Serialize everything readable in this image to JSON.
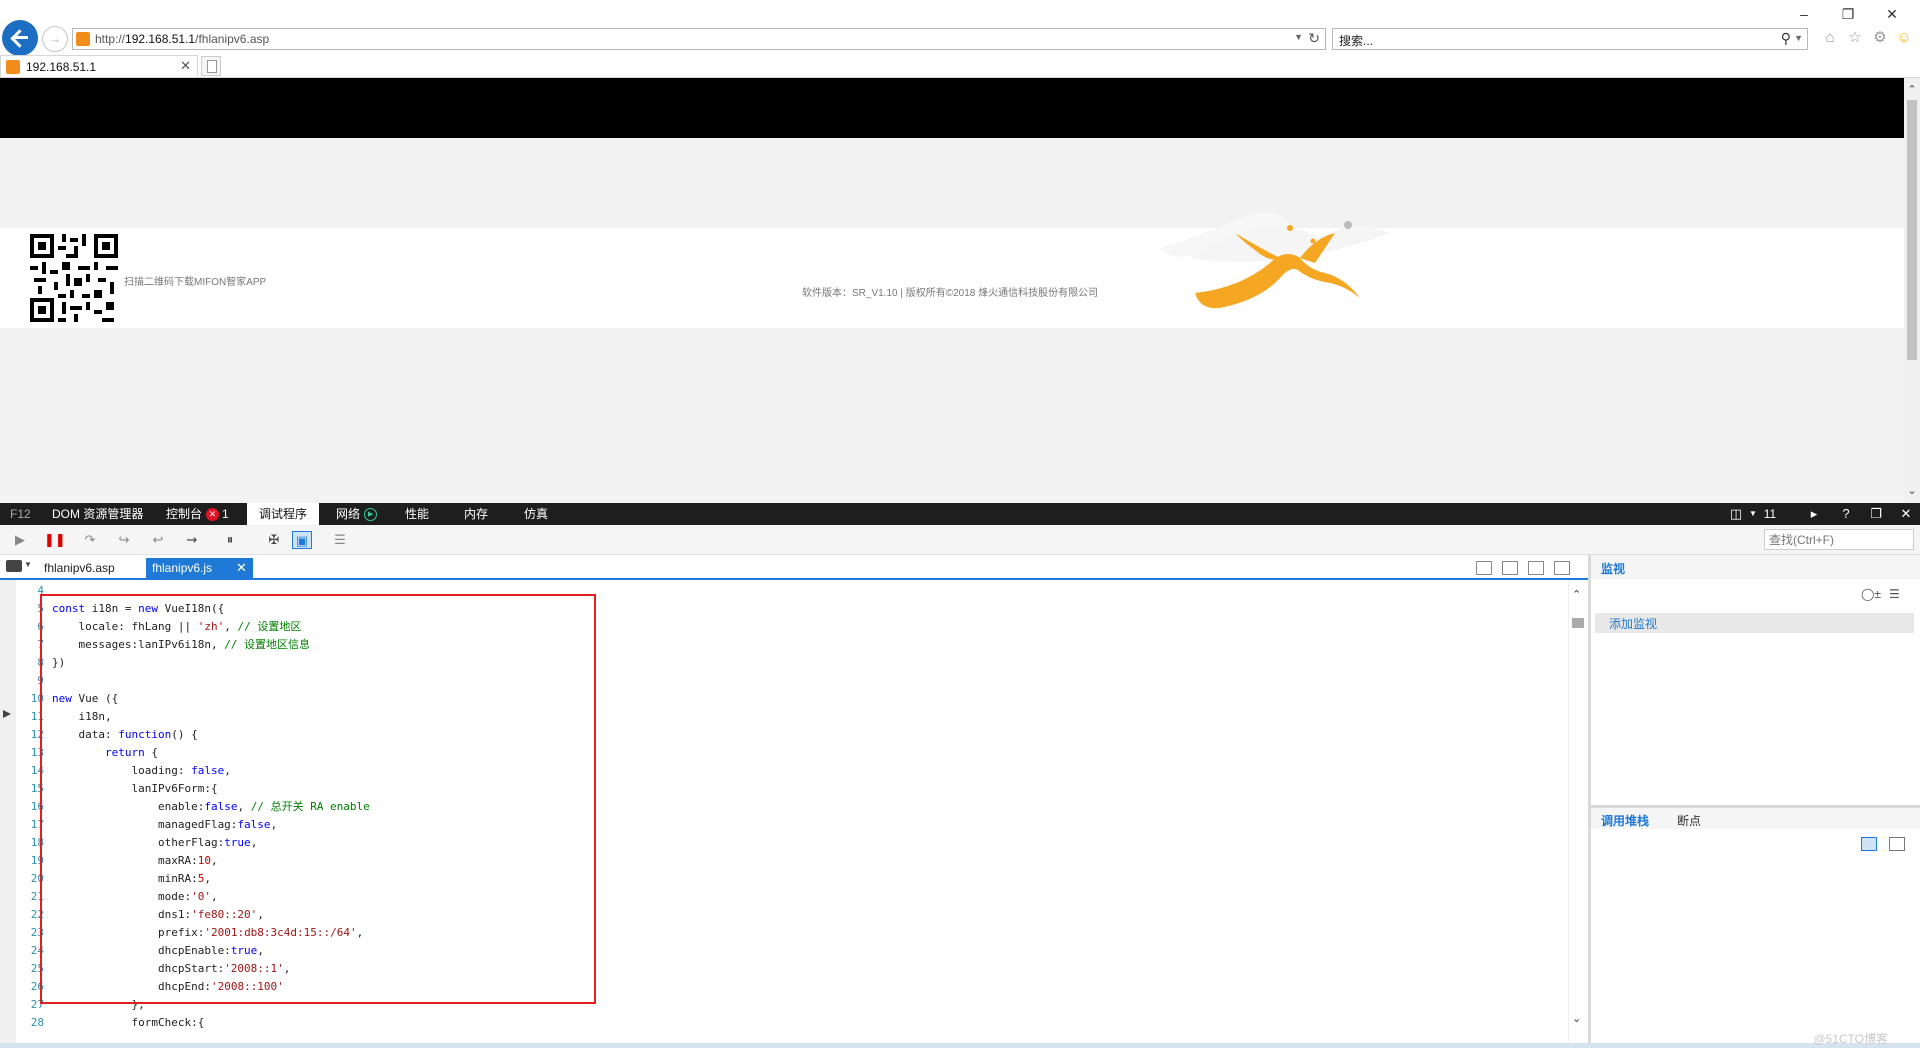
{
  "browser": {
    "url_prefix": "http://",
    "url_host": "192.168.51.1",
    "url_path": "/fhlanipv6.asp",
    "search_placeholder": "搜索...",
    "tab_title": "192.168.51.1"
  },
  "page": {
    "qr_caption": "扫描二维码下载MIFON智家APP",
    "version_text": "软件版本：SR_V1.10 | 版权所有©2018 烽火通信科技股份有限公司"
  },
  "devtools": {
    "tabs": {
      "f12": "F12",
      "dom": "DOM 资源管理器",
      "console": "控制台",
      "console_errors": "1",
      "debugger": "调试程序",
      "network": "网络",
      "performance": "性能",
      "memory": "内存",
      "emulation": "仿真"
    },
    "target_label": "11",
    "find_placeholder": "查找(Ctrl+F)",
    "files": [
      "fhlanipv6.asp",
      "fhlanipv6.js"
    ],
    "watch_title": "监视",
    "add_watch": "添加监视",
    "callstack_title": "调用堆栈",
    "breakpoints_title": "断点",
    "watermark": "@51CTO博客"
  },
  "code": [
    {
      "n": "4",
      "t": ""
    },
    {
      "n": "5",
      "t": "const i18n = new VueI18n({"
    },
    {
      "n": "6",
      "t": "    locale: fhLang || 'zh', // 设置地区"
    },
    {
      "n": "7",
      "t": "    messages:lanIPv6i18n, // 设置地区信息"
    },
    {
      "n": "8",
      "t": "})"
    },
    {
      "n": "9",
      "t": ""
    },
    {
      "n": "10",
      "t": "new Vue ({"
    },
    {
      "n": "11",
      "t": "    i18n,"
    },
    {
      "n": "12",
      "t": "    data: function() {"
    },
    {
      "n": "13",
      "t": "        return {"
    },
    {
      "n": "14",
      "t": "            loading: false,"
    },
    {
      "n": "15",
      "t": "            lanIPv6Form:{"
    },
    {
      "n": "16",
      "t": "                enable:false, // 总开关 RA enable"
    },
    {
      "n": "17",
      "t": "                managedFlag:false,"
    },
    {
      "n": "18",
      "t": "                otherFlag:true,"
    },
    {
      "n": "19",
      "t": "                maxRA:10,"
    },
    {
      "n": "20",
      "t": "                minRA:5,"
    },
    {
      "n": "21",
      "t": "                mode:'0',"
    },
    {
      "n": "22",
      "t": "                dns1:'fe80::20',"
    },
    {
      "n": "23",
      "t": "                prefix:'2001:db8:3c4d:15::/64',"
    },
    {
      "n": "24",
      "t": "                dhcpEnable:true,"
    },
    {
      "n": "25",
      "t": "                dhcpStart:'2008::1',"
    },
    {
      "n": "26",
      "t": "                dhcpEnd:'2008::100'"
    },
    {
      "n": "27",
      "t": "            },"
    },
    {
      "n": "28",
      "t": "            formCheck:{"
    }
  ]
}
